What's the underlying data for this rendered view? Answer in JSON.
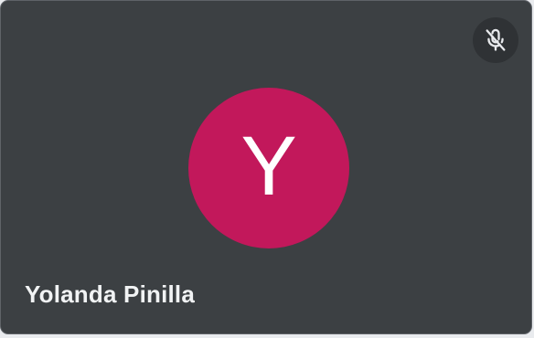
{
  "participant": {
    "name": "Yolanda Pinilla",
    "initial": "Y",
    "avatar_color": "#c2185b",
    "mic_status_icon": "mic-off-icon"
  },
  "colors": {
    "tile_background": "#3c4043",
    "badge_background": "#2f3235",
    "icon_color": "#e8eaed"
  }
}
